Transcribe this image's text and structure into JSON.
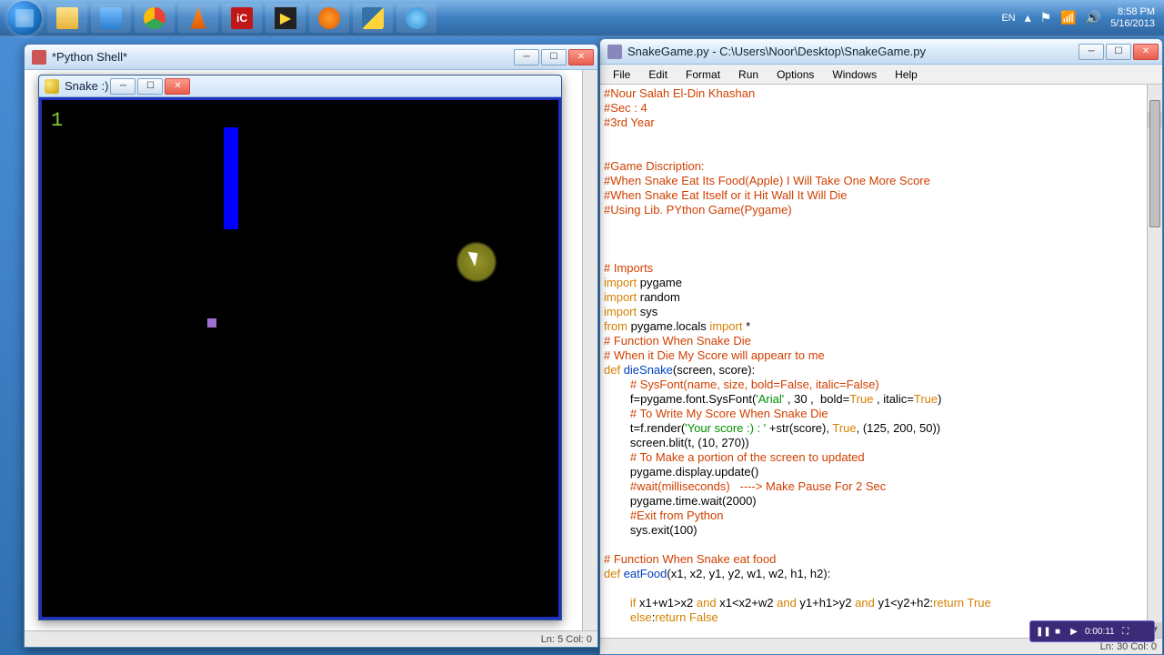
{
  "taskbar": {
    "lang": "EN",
    "time": "8:58 PM",
    "date": "5/16/2013"
  },
  "idle": {
    "title": "SnakeGame.py - C:\\Users\\Noor\\Desktop\\SnakeGame.py",
    "menu": {
      "file": "File",
      "edit": "Edit",
      "format": "Format",
      "run": "Run",
      "options": "Options",
      "windows": "Windows",
      "help": "Help"
    },
    "status": "Ln: 30 Col: 0",
    "code": {
      "l1": "#Nour Salah El-Din Khashan",
      "l2": "#Sec : 4",
      "l3": "#3rd Year",
      "l4": "",
      "l5": "",
      "l6": "#Game Discription:",
      "l7": "#When Snake Eat Its Food(Apple) I Will Take One More Score",
      "l8": "#When Snake Eat Itself or it Hit Wall It Will Die",
      "l9": "#Using Lib. PYthon Game(Pygame)",
      "l10": "",
      "l11": "",
      "l12": "",
      "l13_c": "# Imports",
      "l14_k": "import",
      "l14_r": " pygame",
      "l15_k": "import",
      "l15_r": " random",
      "l16_k": "import",
      "l16_r": " sys",
      "l17_k1": "from",
      "l17_m": " pygame.locals ",
      "l17_k2": "import",
      "l17_r": " *",
      "l18": "# Function When Snake Die",
      "l19": "# When it Die My Score will appearr to me",
      "l20_k": "def ",
      "l20_d": "dieSnake",
      "l20_r": "(screen, score):",
      "l21": "        # SysFont(name, size, bold=False, italic=False)",
      "l22_a": "        f=pygame.font.SysFont(",
      "l22_s": "'Arial'",
      "l22_b": " , 30 ,  bold=",
      "l22_k1": "True",
      "l22_c": " , italic=",
      "l22_k2": "True",
      "l22_d": ")",
      "l23": "        # To Write My Score When Snake Die",
      "l24_a": "        t=f.render(",
      "l24_s": "'Your score :) : '",
      "l24_b": " +str(score), ",
      "l24_k": "True",
      "l24_c": ", (125, 200, 50))",
      "l25": "        screen.blit(t, (10, 270))",
      "l26": "        # To Make a portion of the screen to updated",
      "l27": "        pygame.display.update()",
      "l28": "        #wait(milliseconds)   ----> Make Pause For 2 Sec",
      "l29": "        pygame.time.wait(2000)",
      "l30": "        #Exit from Python",
      "l31": "        sys.exit(100)",
      "l32": "",
      "l33": "# Function When Snake eat food",
      "l34_k": "def ",
      "l34_d": "eatFood",
      "l34_r": "(x1, x2, y1, y2, w1, w2, h1, h2):",
      "l35": "",
      "l36_a": "        if",
      "l36_b": " x1+w1>x2 ",
      "l36_c": "and",
      "l36_d": " x1<x2+w2 ",
      "l36_e": "and",
      "l36_f": " y1+h1>y2 ",
      "l36_g": "and",
      "l36_h": " y1<y2+h2:",
      "l36_i": "return True",
      "l37_a": "        else",
      "l37_b": ":",
      "l37_c": "return ",
      "l37_d": "False"
    }
  },
  "shell": {
    "title": "*Python Shell*",
    "status": "Ln: 5  Col: 0"
  },
  "pygame": {
    "title": "Snake :)",
    "score": "1"
  },
  "media": {
    "time": "0:00:11"
  }
}
